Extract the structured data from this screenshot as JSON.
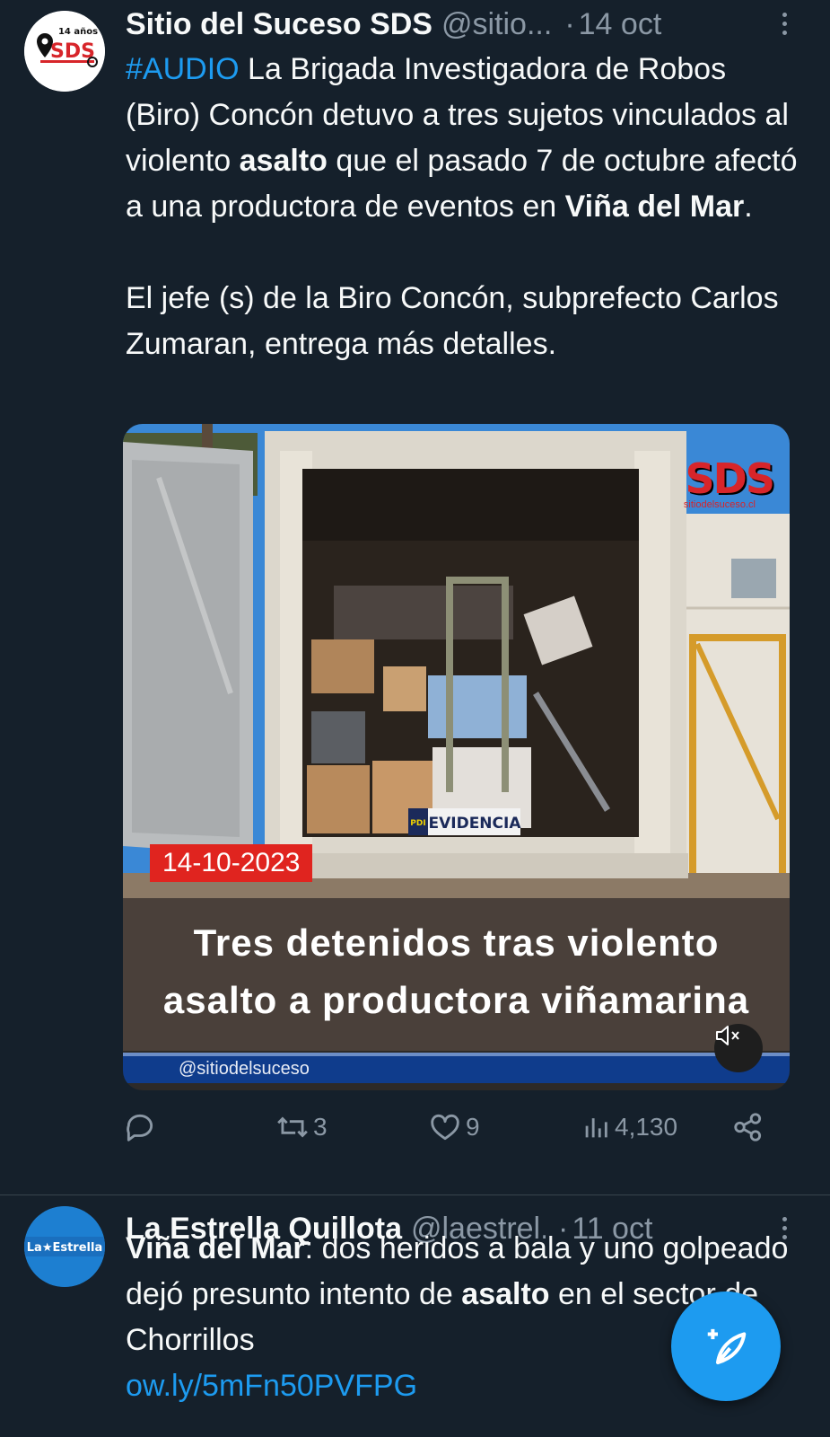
{
  "tweets": [
    {
      "author_name": "Sitio del Suceso SDS",
      "author_handle": "@sitio...",
      "time": "14 oct",
      "avatar": {
        "badge_text": "14 años",
        "logo_text": "SDS"
      },
      "text": {
        "hashtag": "#AUDIO",
        "p1_a": " La Brigada Investigadora de Robos (Biro) Concón detuvo a tres sujetos vinculados al violento ",
        "p1_b": "asalto",
        "p1_c": " que el pasado 7 de octubre afectó a una productora de eventos en ",
        "p1_d": "Viña del Mar",
        "p1_e": ".",
        "p2": "El jefe (s) de la Biro Concón, subprefecto Carlos Zumaran, entrega más detalles."
      },
      "media": {
        "watermark_logo": "SDS",
        "watermark_site": "sitiodelsuceso.cl",
        "date_badge": "14-10-2023",
        "sign_text": "EVIDENCIA",
        "sign_prefix": "PDI",
        "caption_line1": "Tres detenidos tras violento",
        "caption_line2": "asalto a productora viñamarina",
        "credit": "@sitiodelsuceso",
        "mute_icon": "speaker-muted-icon"
      },
      "stats": {
        "replies": "",
        "retweets": "3",
        "likes": "9",
        "views": "4,130"
      }
    },
    {
      "author_name": "La Estrella Quillota",
      "author_handle": "@laestrel...",
      "time": "11 oct",
      "avatar": {
        "logo_text": "La★Estrella"
      },
      "text": {
        "bold_lead": "Viña del Mar",
        "rest": ": dos heridos a bala y uno golpeado dejó presunto intento de ",
        "bold_word": "asalto",
        "rest2": " en el sector de Chorrillos",
        "link": "ow.ly/5mFn50PVFPG"
      }
    }
  ],
  "fab": {
    "icon": "compose-icon"
  },
  "colors": {
    "background": "#15202b",
    "accent": "#1d9bf0",
    "muted": "#8b98a5",
    "text": "#f7f9f9"
  }
}
